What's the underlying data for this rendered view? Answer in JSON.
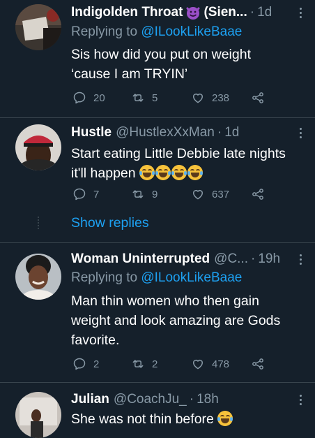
{
  "tweets": [
    {
      "name": "Indigolden Throat",
      "name_suffix": "(Sien...",
      "handle": "",
      "time": "1d",
      "reply_prefix": "Replying to",
      "reply_mention": "@ILookLikeBaae",
      "text_lines": [
        "Sis how did you put on weight",
        "‘cause I am TRYIN’"
      ],
      "replies": "20",
      "retweets": "5",
      "likes": "238"
    },
    {
      "name": "Hustle",
      "handle": "@HustlexXxMan",
      "time": "1d",
      "text_lines": [
        "Start eating Little Debbie late nights",
        "it'll happen"
      ],
      "replies": "7",
      "retweets": "9",
      "likes": "637"
    },
    {
      "name": "Woman Uninterrupted",
      "handle": "@C...",
      "time": "19h",
      "reply_prefix": "Replying to",
      "reply_mention": "@ILookLikeBaae",
      "text_lines": [
        "Man thin women who then gain",
        "weight and look amazing are Gods",
        "favorite."
      ],
      "replies": "2",
      "retweets": "2",
      "likes": "478"
    },
    {
      "name": "Julian",
      "handle": "@CoachJu_",
      "time": "18h",
      "text_lines": [
        "She was not thin before"
      ]
    }
  ],
  "show_replies": "Show replies",
  "separator": "·",
  "icons": {
    "reply": "reply-icon",
    "retweet": "retweet-icon",
    "like": "heart-icon",
    "share": "share-icon",
    "devil": "smiling-devil-emoji",
    "laugh": "tears-of-joy-emoji"
  },
  "colors": {
    "background": "#15202b",
    "accent": "#1da1f2",
    "muted": "#8899a6",
    "divider": "#38444d"
  }
}
